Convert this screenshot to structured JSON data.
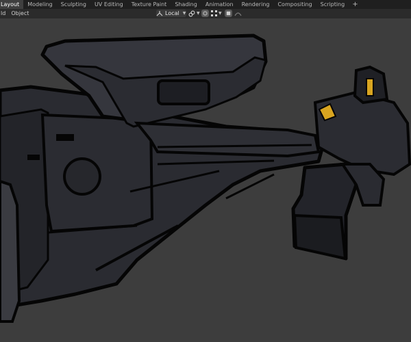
{
  "workspaces": {
    "tabs": [
      {
        "label": "Layout",
        "active": true
      },
      {
        "label": "Modeling"
      },
      {
        "label": "Sculpting"
      },
      {
        "label": "UV Editing"
      },
      {
        "label": "Texture Paint"
      },
      {
        "label": "Shading"
      },
      {
        "label": "Animation"
      },
      {
        "label": "Rendering"
      },
      {
        "label": "Compositing"
      },
      {
        "label": "Scripting"
      }
    ],
    "add_label": "+"
  },
  "header": {
    "menu": [
      "ld",
      "Object"
    ],
    "transform_orientation": "Local",
    "icons": [
      "orientation-axes-icon",
      "pivot-link-icon",
      "snap-icon",
      "snap-grid-icon",
      "proportional-edit-icon",
      "falloff-curve-icon"
    ]
  },
  "colors": {
    "viewport_bg": "#3d3d3d",
    "mesh_dark": "#1e1f24",
    "mesh_mid": "#2c2d33",
    "outline": "#050505",
    "accent_yellow": "#d9a520"
  }
}
